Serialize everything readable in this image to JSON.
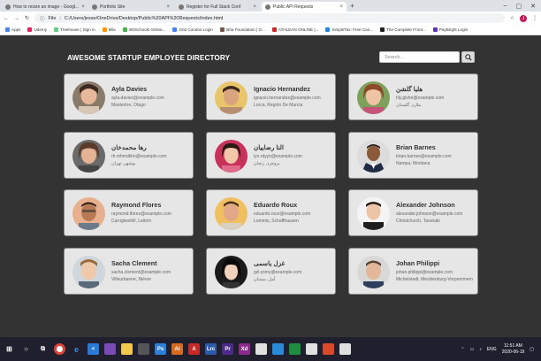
{
  "browser": {
    "tabs": [
      {
        "title": "How to resize an image - Googl...",
        "active": false
      },
      {
        "title": "Portfolio Site",
        "active": false
      },
      {
        "title": "Register for Full Stack Conf",
        "active": false
      },
      {
        "title": "Public API Requests",
        "active": true
      }
    ],
    "address_prefix": "File",
    "address": "C:/Users/jesse/OneDrive/Desktop/Public%20API%20Requests/index.html",
    "profile_initial": "J",
    "bookmarks": [
      "Apps",
      "Udemy",
      "Treehouse | Sign in",
      "Mlix",
      "W3Schools Online...",
      "Grid Condos Login",
      "Isha Foundation | O...",
      "ATHLEAN ONLINE |...",
      "SimpleTax: Free Can...",
      "The Complete Front...",
      "PayBright Login"
    ]
  },
  "page": {
    "title": "AWESOME STARTUP EMPLOYEE DIRECTORY",
    "search_placeholder": "Search..."
  },
  "employees": [
    {
      "name": "Ayla Davies",
      "email": "ayla.davies@example.com",
      "location": "Masterton, Otago"
    },
    {
      "name": "Ignacio Hernandez",
      "email": "ignacio.hernandez@example.com",
      "location": "Lorca, Región De Murcia"
    },
    {
      "name": "هلیا گلشن",
      "email": "hly.glshn@example.com",
      "location": "ملارد, گلستان"
    },
    {
      "name": "رها محمدخان",
      "email": "rh.mhmdkhn@example.com",
      "location": "بوشهر, تهران"
    },
    {
      "name": "النا رضاییان",
      "email": "lyn.rdyyn@example.com",
      "location": "بروجرد, زنجان"
    },
    {
      "name": "Brian Barnes",
      "email": "brian.barnes@example.com",
      "location": "Nampa, Montana"
    },
    {
      "name": "Raymond Flores",
      "email": "raymond.flores@example.com",
      "location": "Carrigtwohill, Leitrim"
    },
    {
      "name": "Eduardo Roux",
      "email": "eduardo.roux@example.com",
      "location": "Lommis, Schaffhausen"
    },
    {
      "name": "Alexander Johnson",
      "email": "alexander.johnson@example.com",
      "location": "Christchurch, Taranaki"
    },
    {
      "name": "Sacha Clement",
      "email": "sacha.clement@example.com",
      "location": "Villeurbanne, Nièvre"
    },
    {
      "name": "غزل یاسمی",
      "email": "gzl.ysmy@example.com",
      "location": "آمل, سمنان"
    },
    {
      "name": "Johan Philippi",
      "email": "johan.philippi@example.com",
      "location": "Michelstadt, Mecklenburg-Vorpommern"
    }
  ],
  "taskbar": {
    "language": "ENG",
    "time": "11:51 AM",
    "date": "2020-06-19"
  }
}
